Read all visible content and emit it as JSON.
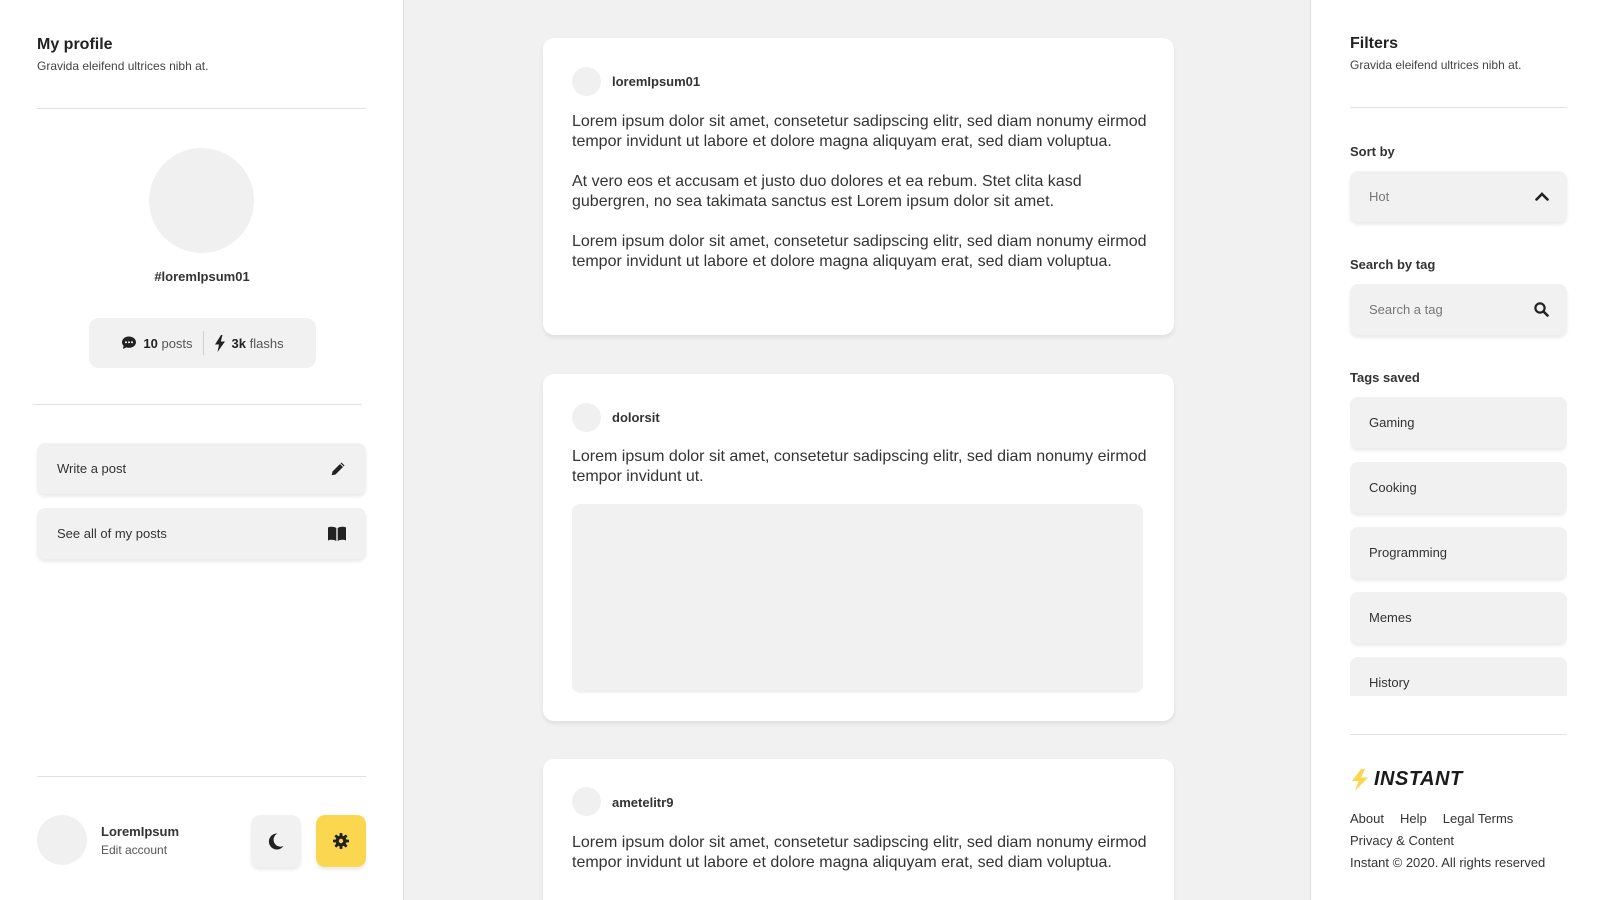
{
  "profile": {
    "title": "My profile",
    "subtitle": "Gravida eleifend ultrices nibh at.",
    "handle": "#loremIpsum01",
    "stats": {
      "posts_count": "10",
      "posts_label": "posts",
      "flashs_count": "3k",
      "flashs_label": "flashs"
    },
    "actions": [
      {
        "label": "Write a post",
        "icon": "pencil-icon"
      },
      {
        "label": "See all of my posts",
        "icon": "book-icon"
      }
    ],
    "account": {
      "name": "LoremIpsum",
      "edit_label": "Edit account"
    },
    "accent_color": "#fbd74f"
  },
  "feed": {
    "posts": [
      {
        "username": "loremIpsum01",
        "paragraphs": [
          "Lorem ipsum dolor sit amet, consetetur sadipscing elitr, sed diam nonumy eirmod tempor invidunt ut labore et dolore magna aliquyam erat, sed diam voluptua.",
          "At vero eos et accusam et justo duo dolores et ea rebum. Stet clita kasd gubergren, no sea takimata sanctus est Lorem ipsum dolor sit amet.",
          "Lorem ipsum dolor sit amet, consetetur sadipscing elitr, sed diam nonumy eirmod tempor invidunt ut labore et dolore magna aliquyam erat, sed diam voluptua."
        ]
      },
      {
        "username": "dolorsit",
        "paragraphs": [
          "Lorem ipsum dolor sit amet, consetetur sadipscing elitr, sed diam nonumy eirmod tempor invidunt ut."
        ]
      },
      {
        "username": "ametelitr9",
        "paragraphs": [
          "Lorem ipsum dolor sit amet, consetetur sadipscing elitr, sed diam nonumy eirmod tempor invidunt ut labore et dolore magna aliquyam erat, sed diam voluptua."
        ]
      }
    ]
  },
  "filters": {
    "title": "Filters",
    "subtitle": "Gravida eleifend ultrices nibh at.",
    "sort_label": "Sort by",
    "sort_value": "Hot",
    "search_label": "Search by tag",
    "search_placeholder": "Search a tag",
    "tags_label": "Tags saved",
    "tags": [
      "Gaming",
      "Cooking",
      "Programming",
      "Memes",
      "History"
    ]
  },
  "footer": {
    "brand": "INSTANT",
    "links": [
      "About",
      "Help",
      "Legal Terms",
      "Privacy & Content"
    ],
    "copyright": "Instant © 2020. All rights reserved"
  }
}
